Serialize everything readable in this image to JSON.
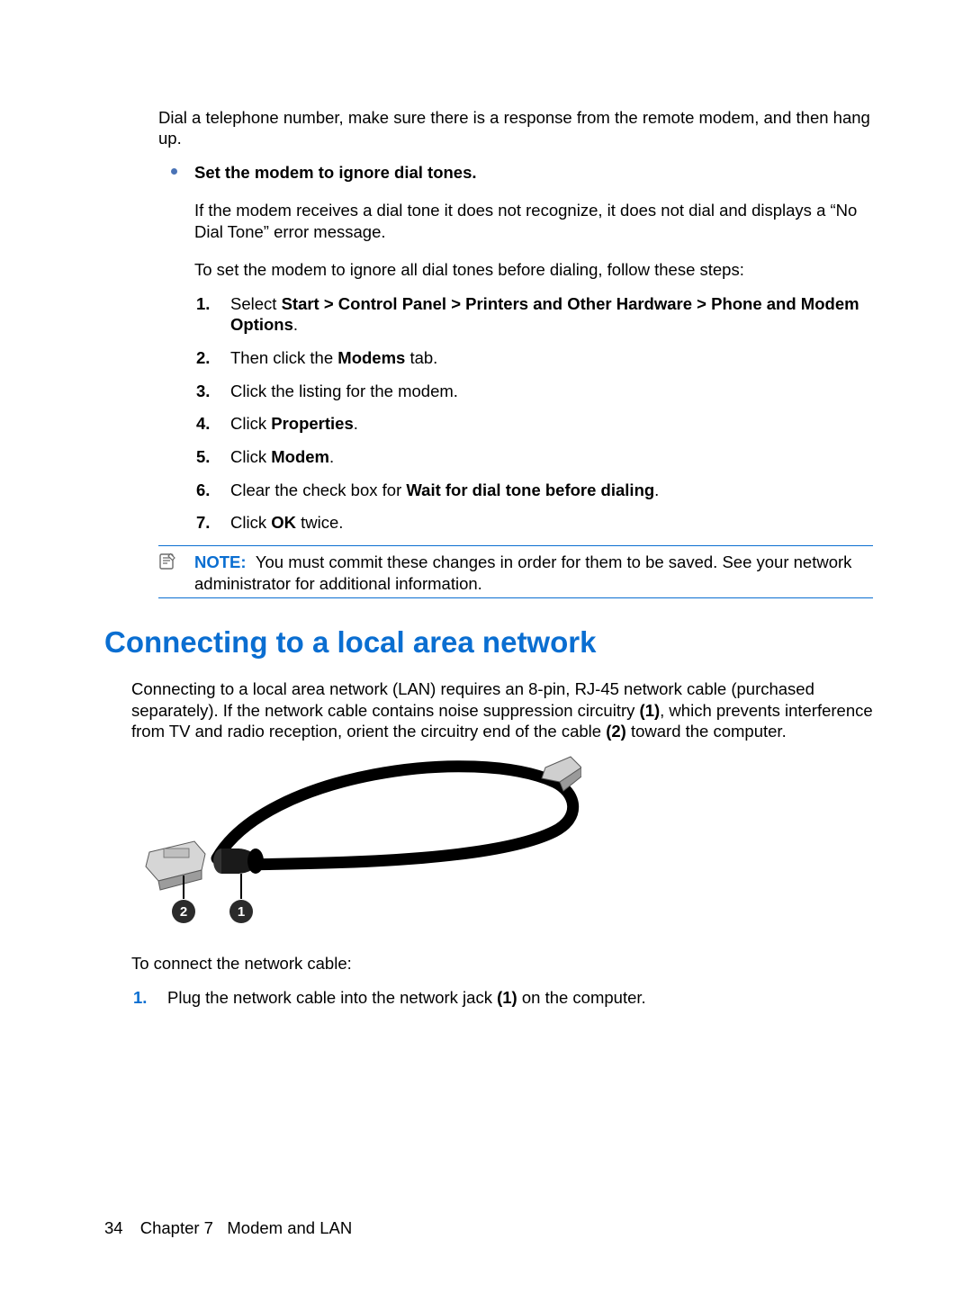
{
  "intro_para": "Dial a telephone number, make sure there is a response from the remote modem, and then hang up.",
  "bullet_heading": "Set the modem to ignore dial tones.",
  "bullet_p1": "If the modem receives a dial tone it does not recognize, it does not dial and displays a “No Dial Tone” error message.",
  "bullet_p2": "To set the modem to ignore all dial tones before dialing, follow these steps:",
  "steps": [
    {
      "num": "1.",
      "pre": "Select ",
      "bold": "Start > Control Panel > Printers and Other Hardware > Phone and Modem Options",
      "post": "."
    },
    {
      "num": "2.",
      "pre": "Then click the ",
      "bold": "Modems",
      "post": " tab."
    },
    {
      "num": "3.",
      "pre": "Click the listing for the modem.",
      "bold": "",
      "post": ""
    },
    {
      "num": "4.",
      "pre": "Click ",
      "bold": "Properties",
      "post": "."
    },
    {
      "num": "5.",
      "pre": "Click ",
      "bold": "Modem",
      "post": "."
    },
    {
      "num": "6.",
      "pre": "Clear the check box for ",
      "bold": "Wait for dial tone before dialing",
      "post": "."
    },
    {
      "num": "7.",
      "pre": "Click ",
      "bold": "OK",
      "post": " twice."
    }
  ],
  "note_label": "NOTE:",
  "note_text": "You must commit these changes in order for them to be saved. See your network administrator for additional information.",
  "section_heading": "Connecting to a local area network",
  "lan_p1_pre": "Connecting to a local area network (LAN) requires an 8-pin, RJ-45 network cable (purchased separately). If the network cable contains noise suppression circuitry ",
  "lan_p1_b1": "(1)",
  "lan_p1_mid": ", which prevents interference from TV and radio reception, orient the circuitry end of the cable ",
  "lan_p1_b2": "(2)",
  "lan_p1_post": " toward the computer.",
  "figure_callouts": {
    "one": "1",
    "two": "2"
  },
  "lan_p2": "To connect the network cable:",
  "lan_steps": [
    {
      "num": "1.",
      "pre": "Plug the network cable into the network jack ",
      "bold": "(1)",
      "post": " on the computer."
    }
  ],
  "footer": {
    "page": "34",
    "chapter": "Chapter 7   Modem and LAN"
  }
}
